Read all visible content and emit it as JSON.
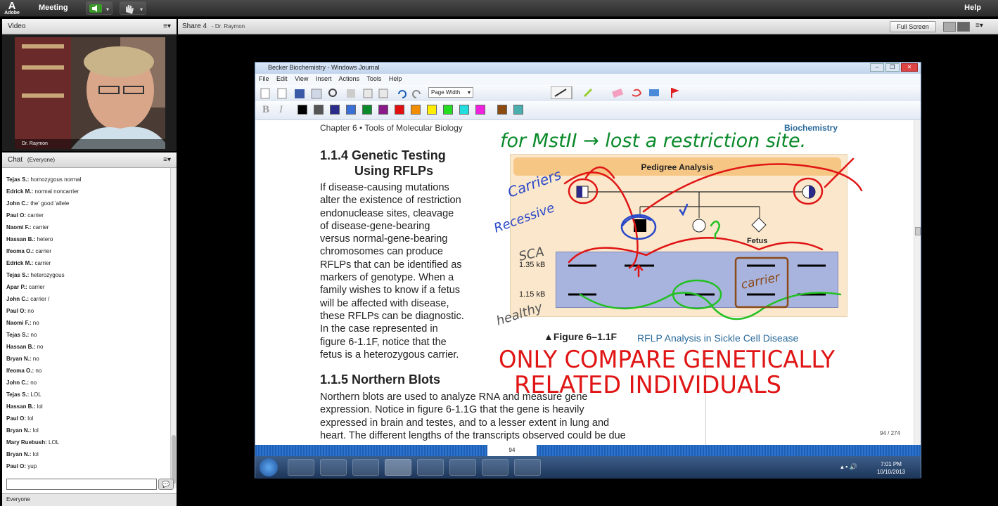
{
  "topbar": {
    "adobe_label": "Adobe",
    "meeting_label": "Meeting",
    "help_label": "Help"
  },
  "video": {
    "title": "Video",
    "presenter": "Dr. Raymon"
  },
  "chat": {
    "title": "Chat",
    "audience": "(Everyone)",
    "messages": [
      {
        "name": "Tejas S.:",
        "text": "homozygous normal"
      },
      {
        "name": "Edrick M.:",
        "text": "normal noncarrier"
      },
      {
        "name": "John C.:",
        "text": "the' good 'allele"
      },
      {
        "name": "Paul O:",
        "text": "carrier"
      },
      {
        "name": "Naomi F.:",
        "text": "carrier"
      },
      {
        "name": "Hassan B.:",
        "text": "hetero"
      },
      {
        "name": "Ifeoma O.:",
        "text": "carrier"
      },
      {
        "name": "Edrick M.:",
        "text": "carrier"
      },
      {
        "name": "Tejas S.:",
        "text": "heterozygous"
      },
      {
        "name": "Apar P.:",
        "text": "carrier"
      },
      {
        "name": "John C.:",
        "text": "carrier /"
      },
      {
        "name": "Paul O:",
        "text": "no"
      },
      {
        "name": "Naomi F.:",
        "text": "no"
      },
      {
        "name": "Tejas S.:",
        "text": "no"
      },
      {
        "name": "Hassan B.:",
        "text": "no"
      },
      {
        "name": "Bryan N.:",
        "text": "no"
      },
      {
        "name": "Ifeoma O.:",
        "text": "no"
      },
      {
        "name": "John C.:",
        "text": "no"
      },
      {
        "name": "Tejas S.:",
        "text": "LOL"
      },
      {
        "name": "Hassan B.:",
        "text": "lol"
      },
      {
        "name": "Paul O:",
        "text": "lol"
      },
      {
        "name": "Bryan N.:",
        "text": "lol"
      },
      {
        "name": "Mary Ruebush:",
        "text": "LOL"
      },
      {
        "name": "Bryan N.:",
        "text": "lol"
      },
      {
        "name": "Paul O:",
        "text": "yup"
      }
    ],
    "footer": "Everyone"
  },
  "share": {
    "title": "Share 4",
    "subtitle": "- Dr. Raymon",
    "fullscreen_label": "Full Screen"
  },
  "journal": {
    "title": "Becker Biochemistry - Windows Journal",
    "menu": [
      "File",
      "Edit",
      "View",
      "Insert",
      "Actions",
      "Tools",
      "Help"
    ],
    "zoom": "Page Width",
    "page_counter": "94 / 274",
    "page_number": "94",
    "swatches": [
      "#000000",
      "#555555",
      "#2b2b8c",
      "#3a6fd8",
      "#0a8a2a",
      "#8a1a8a",
      "#e01010",
      "#f28c00",
      "#ffee00",
      "#22dd22",
      "#22dddd",
      "#ee22dd",
      "#8a4a10",
      "#4aaeae"
    ]
  },
  "doc": {
    "chapter": "Chapter 6 • Tools of Molecular Biology",
    "biochem": "Biochemistry",
    "h114a": "1.1.4 Genetic Testing",
    "h114b": "Using RFLPs",
    "p114": [
      "If disease-causing mutations",
      "alter the existence of restriction",
      "endonuclease sites, cleavage",
      "of disease-gene-bearing",
      "versus normal-gene-bearing",
      "chromosomes can produce",
      "RFLPs that can be identified as",
      "markers of genotype. When a",
      "family wishes to know if a fetus",
      "will be affected with disease,",
      "these RFLPs can be diagnostic.",
      "In the case represented in",
      "figure 6-1.1F, notice that the",
      "fetus is a heterozygous carrier."
    ],
    "h115": "1.1.5 Northern Blots",
    "p115": [
      "Northern blots are used to analyze RNA and measure gene",
      "expression. Notice in figure 6-1.1G that the gene is heavily",
      "expressed in brain and testes, and to a lesser extent in lung and",
      "heart. The different lengths of the transcripts observed could be due"
    ],
    "pedigree_title": "Pedigree Analysis",
    "fetus": "Fetus",
    "kb1": "1.35 kB",
    "kb2": "1.15 kB",
    "fig_label": "▲Figure  6–1.1F",
    "fig_caption": "RFLP Analysis in Sickle Cell Disease",
    "ink_top": "for MstII → lost a restriction site.",
    "ink_carriers": "Carriers",
    "ink_recessive": "Recessive",
    "ink_sca": "SCA",
    "ink_healthy": "healthy",
    "ink_carrier_box": "carrier",
    "ink_only1": "ONLY COMPARE GENETICALLY",
    "ink_only2": "RELATED INDIVIDUALS"
  },
  "clock": {
    "time": "7:01 PM",
    "date": "10/10/2013"
  }
}
